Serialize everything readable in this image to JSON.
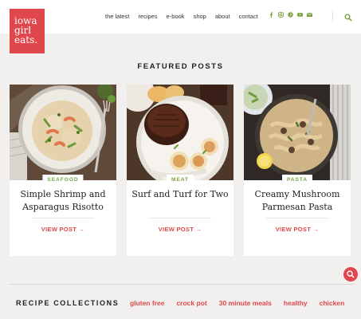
{
  "logo": {
    "line1": "iowa",
    "line2": "girl",
    "line3": "eats."
  },
  "nav": {
    "items": [
      "the latest",
      "recipes",
      "e-book",
      "shop",
      "about",
      "contact"
    ]
  },
  "social": {
    "icons": [
      "facebook-icon",
      "instagram-icon",
      "pinterest-icon",
      "youtube-icon",
      "email-icon"
    ]
  },
  "featured": {
    "title": "FEATURED POSTS"
  },
  "cards": [
    {
      "badge": "SEAFOOD",
      "title": "Simple Shrimp and Asparagus Risotto",
      "link": "VIEW POST →"
    },
    {
      "badge": "MEAT",
      "title": "Surf and Turf for Two",
      "link": "VIEW POST →"
    },
    {
      "badge": "PASTA",
      "title": "Creamy Mushroom Parmesan Pasta",
      "link": "VIEW POST →"
    }
  ],
  "collections": {
    "label": "RECIPE COLLECTIONS",
    "items": [
      "gluten free",
      "crock pot",
      "30 minute meals",
      "healthy",
      "chicken"
    ]
  },
  "colors": {
    "accent": "#e0474c",
    "green": "#7aa03e",
    "background": "#f2f0ee"
  }
}
